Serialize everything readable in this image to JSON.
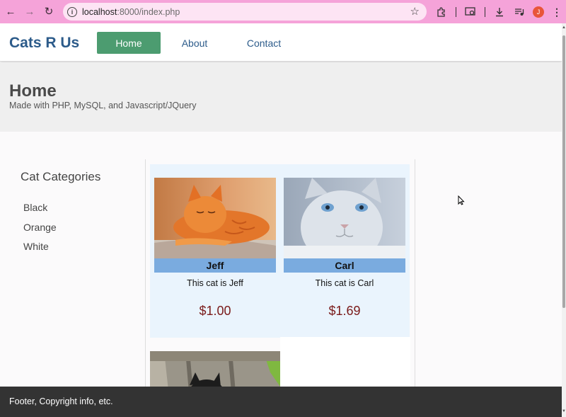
{
  "browser": {
    "url_host": "localhost",
    "url_path": ":8000/index.php",
    "profile_initial": "J"
  },
  "site": {
    "brand": "Cats R Us",
    "nav": [
      {
        "label": "Home",
        "active": true
      },
      {
        "label": "About",
        "active": false
      },
      {
        "label": "Contact",
        "active": false
      }
    ],
    "hero_title": "Home",
    "hero_subtitle": "Made with PHP, MySQL, and Javascript/JQuery"
  },
  "sidebar": {
    "title": "Cat Categories",
    "categories": [
      "Black",
      "Orange",
      "White"
    ]
  },
  "products": [
    {
      "name": "Jeff",
      "description": "This cat is Jeff",
      "price": "$1.00"
    },
    {
      "name": "Carl",
      "description": "This cat is Carl",
      "price": "$1.69"
    }
  ],
  "footer": {
    "text": "Footer, Copyright info, etc."
  }
}
